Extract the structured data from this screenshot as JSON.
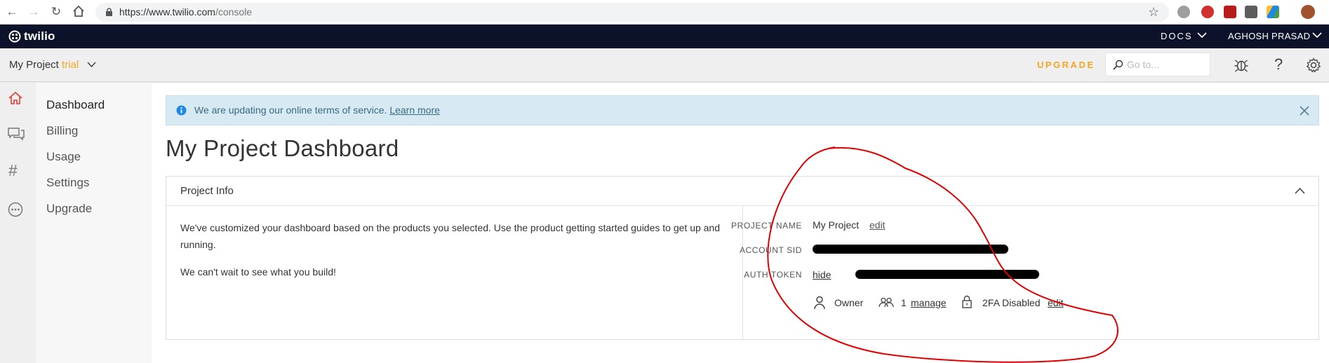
{
  "browser": {
    "url_host": "https://www.twilio.com",
    "url_path": "/console"
  },
  "topbar": {
    "logo": "twilio",
    "docs_label": "DOCS",
    "user_label": "AGHOSH PRASAD"
  },
  "projectbar": {
    "project_name": "My Project",
    "project_status": "trial",
    "upgrade_label": "UPGRADE",
    "search_placeholder": "Go to..."
  },
  "sidebar": {
    "icons": [
      "home-icon",
      "chat-icon",
      "hash-icon",
      "more-icon"
    ],
    "items": [
      {
        "label": "Dashboard",
        "active": true
      },
      {
        "label": "Billing"
      },
      {
        "label": "Usage"
      },
      {
        "label": "Settings"
      },
      {
        "label": "Upgrade"
      }
    ]
  },
  "banner": {
    "text": "We are updating our online terms of service.",
    "link": "Learn more"
  },
  "page": {
    "title": "My Project Dashboard"
  },
  "project_info": {
    "header": "Project Info",
    "paragraphs": [
      "We've customized your dashboard based on the products you selected. Use the product getting started guides to get up and running.",
      "We can't wait to see what you build!"
    ],
    "fields": {
      "project_name_label": "PROJECT NAME",
      "project_name_value": "My Project",
      "project_name_edit": "edit",
      "account_sid_label": "ACCOUNT SID",
      "auth_token_label": "AUTH TOKEN",
      "auth_token_toggle": "hide"
    },
    "meta": {
      "role": "Owner",
      "user_count": "1",
      "manage_label": "manage",
      "twofa_status": "2FA Disabled",
      "twofa_edit": "edit"
    }
  },
  "colors": {
    "accent": "#f5a623",
    "topbar": "#0d122b",
    "banner_bg": "#d7eaf3",
    "annotation": "#e00000"
  }
}
